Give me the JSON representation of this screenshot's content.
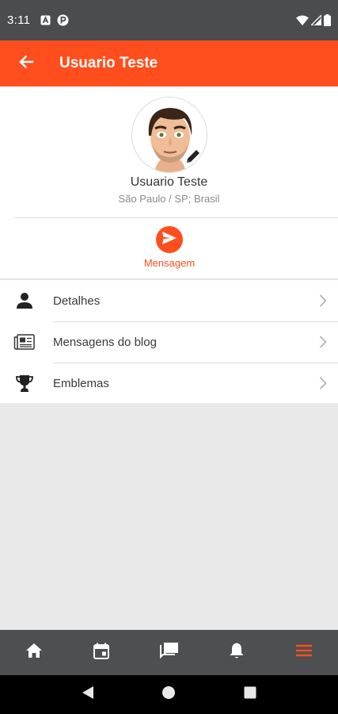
{
  "status_bar": {
    "time": "3:11",
    "left_icons": [
      "notification-a-icon",
      "notification-p-icon"
    ],
    "right_icons": [
      "wifi-icon",
      "cell-signal-icon",
      "battery-icon"
    ]
  },
  "app_bar": {
    "title": "Usuario Teste",
    "back_icon": "arrow-back-icon",
    "background": "#ff4e1d"
  },
  "profile": {
    "name": "Usuario Teste",
    "location": "São Paulo / SP; Brasil",
    "edit_icon": "pencil-icon"
  },
  "message_action": {
    "label": "Mensagem",
    "icon": "send-icon"
  },
  "menu": {
    "items": [
      {
        "label": "Detalhes",
        "icon": "person-icon"
      },
      {
        "label": "Mensagens do blog",
        "icon": "newspaper-icon"
      },
      {
        "label": "Emblemas",
        "icon": "trophy-icon"
      }
    ]
  },
  "bottom_nav": {
    "items": [
      {
        "icon": "home-icon",
        "active": false
      },
      {
        "icon": "calendar-icon",
        "active": false
      },
      {
        "icon": "chat-icon",
        "active": false
      },
      {
        "icon": "bell-icon",
        "active": false
      },
      {
        "icon": "menu-icon",
        "active": true
      }
    ]
  },
  "system_nav": {
    "items": [
      "back-triangle-icon",
      "home-circle-icon",
      "recents-square-icon"
    ]
  },
  "colors": {
    "accent": "#ff4e1d",
    "status_bar": "#4a4c4d",
    "bottom_nav": "#4d4f50",
    "background": "#e9e9e9"
  }
}
